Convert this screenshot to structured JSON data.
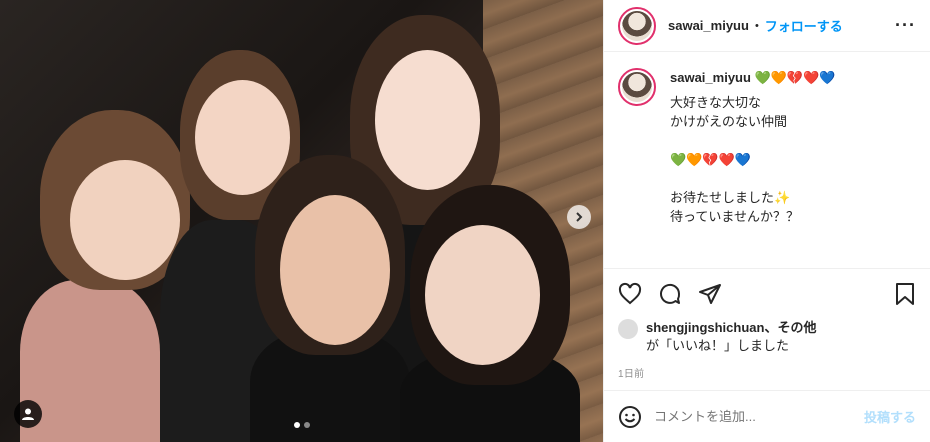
{
  "post": {
    "photo_alt": "",
    "carousel": {
      "count": 2,
      "active": 0
    }
  },
  "header": {
    "username": "sawai_miyuu",
    "bullet": "•",
    "follow_label": "フォローする",
    "more_label": "···"
  },
  "caption": {
    "username": "sawai_miyuu",
    "emoji": "💚🧡💔❤️💙",
    "lines": [
      "大好きな大切な",
      "かけがえのない仲間",
      "",
      "💚🧡💔❤️💙",
      "",
      "お待たせしました✨",
      "待っていませんか？？"
    ]
  },
  "likes": {
    "liker": "shengjingshichuan",
    "others": "、その他",
    "suffix": "が「いいね！」しました"
  },
  "timestamp": "1日前",
  "comment": {
    "placeholder": "コメントを追加...",
    "post_label": "投稿する"
  },
  "icons": {
    "like": "heart-icon",
    "comment": "comment-icon",
    "share": "share-icon",
    "save": "bookmark-icon",
    "emoji": "smiley-icon",
    "tag": "person-tag-icon",
    "next": "chevron-right-icon"
  },
  "colors": {
    "follow": "#0095f6",
    "avatar_ring": "#e1306c",
    "post_disabled": "#b2dffc",
    "muted": "#8e8e8e"
  }
}
